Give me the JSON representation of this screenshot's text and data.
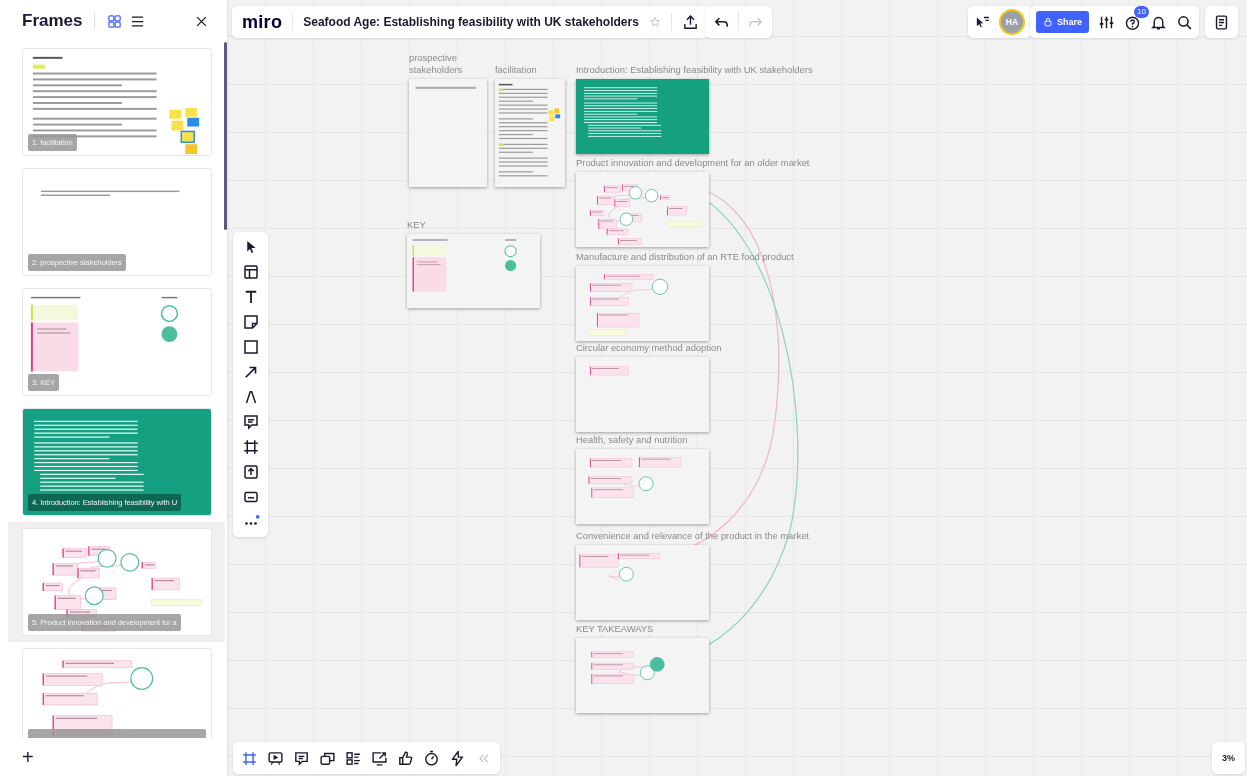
{
  "sidebar": {
    "title": "Frames",
    "view_modes": [
      {
        "kind": "grid",
        "selected": true
      },
      {
        "kind": "list",
        "selected": false
      }
    ],
    "frames": [
      {
        "label": "1. facilitation",
        "kind": "document",
        "selected": false
      },
      {
        "label": "2. prospective stakeholders",
        "kind": "note",
        "selected": false
      },
      {
        "label": "3. KEY",
        "kind": "key",
        "selected": false
      },
      {
        "label": "4. Introduction: Establishing feasibility with U",
        "kind": "intro",
        "selected": false
      },
      {
        "label": "5. Product innovation and development for a",
        "kind": "map",
        "selected": true
      },
      {
        "kind": "map",
        "selected": false
      }
    ],
    "add_button": "+"
  },
  "toolbar": {
    "logo": "miro",
    "board_title": "Seafood Age: Establishing feasibility with UK stakeholders",
    "starred": false,
    "redo_disabled": true,
    "avatar_initials": "HA",
    "share_label": "Share",
    "help_badge": "10"
  },
  "tools": [
    {
      "kind": "select"
    },
    {
      "kind": "templates"
    },
    {
      "kind": "text"
    },
    {
      "kind": "sticky"
    },
    {
      "kind": "shape"
    },
    {
      "kind": "arrow"
    },
    {
      "kind": "pen"
    },
    {
      "kind": "comment"
    },
    {
      "kind": "frame"
    },
    {
      "kind": "upload"
    },
    {
      "kind": "card"
    },
    {
      "kind": "more"
    }
  ],
  "canvas": {
    "frames": [
      {
        "label": "prospective stakeholders",
        "kind": "note"
      },
      {
        "label": "facilitation",
        "kind": "document"
      },
      {
        "label": "Introduction: Establishing feasibility with UK stakeholders",
        "kind": "intro"
      },
      {
        "label": "Product innovation and development for an older market",
        "kind": "map"
      },
      {
        "label": "KEY",
        "kind": "key"
      },
      {
        "label": "Manufacture and distribution of an RTE food product",
        "kind": "map"
      },
      {
        "label": "Circular economy method adoption",
        "kind": "map"
      },
      {
        "label": "Health, safety and nutrition",
        "kind": "map"
      },
      {
        "label": "Convenience and relevance of the product in the market",
        "kind": "map"
      },
      {
        "label": "KEY TAKEAWAYS",
        "kind": "map"
      }
    ]
  },
  "bottom_tools": [
    {
      "kind": "frames",
      "selected": true
    },
    {
      "kind": "presentation",
      "selected": false
    },
    {
      "kind": "comments",
      "selected": false
    },
    {
      "kind": "cards",
      "selected": false
    },
    {
      "kind": "kanban",
      "selected": false
    },
    {
      "kind": "share-screen",
      "selected": false
    },
    {
      "kind": "reactions",
      "selected": false
    },
    {
      "kind": "timer",
      "selected": false
    },
    {
      "kind": "lightning",
      "selected": false
    }
  ],
  "zoom_level": "3%"
}
